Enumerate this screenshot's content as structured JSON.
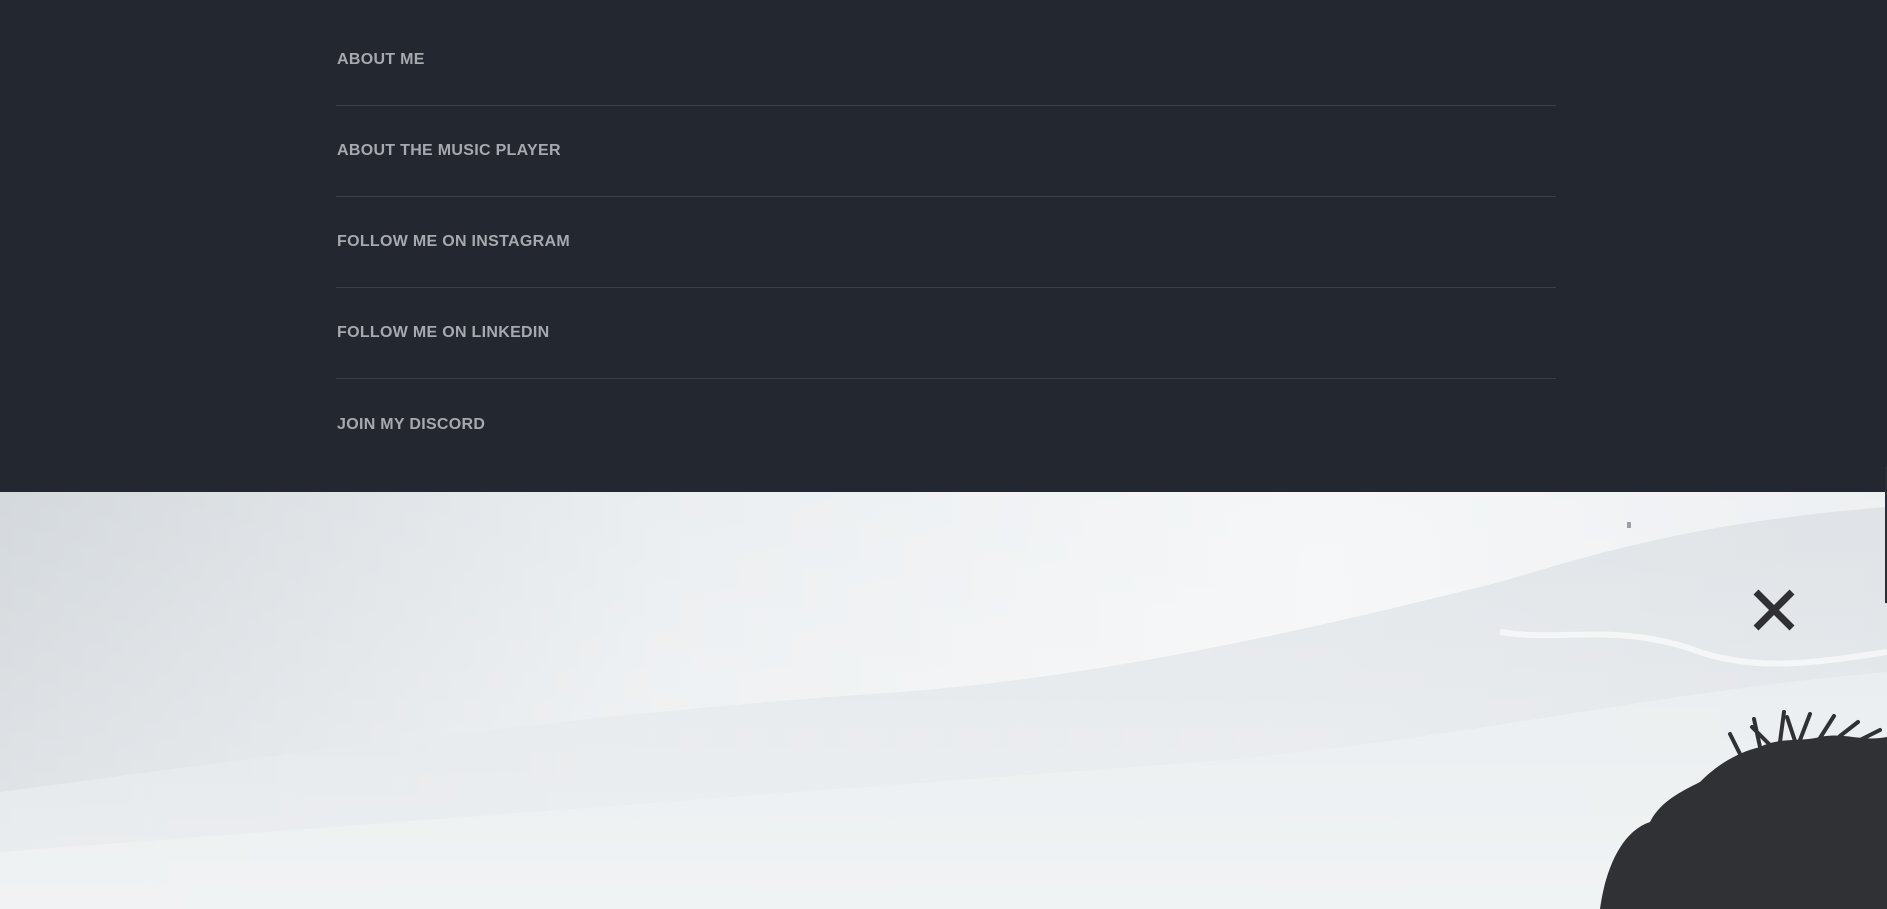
{
  "menu": {
    "items": [
      {
        "label": "ABOUT ME"
      },
      {
        "label": "ABOUT THE MUSIC PLAYER"
      },
      {
        "label": "FOLLOW ME ON INSTAGRAM"
      },
      {
        "label": "FOLLOW ME ON LINKEDIN"
      },
      {
        "label": "JOIN MY DISCORD"
      }
    ]
  },
  "close_button": {
    "icon": "close-icon"
  },
  "hero": {
    "image": "misty-mountain-landscape"
  },
  "colors": {
    "menu_background": "#232730",
    "menu_text": "#a6a9ae",
    "divider": "#3a3f48",
    "close_icon": "#2e3034"
  }
}
